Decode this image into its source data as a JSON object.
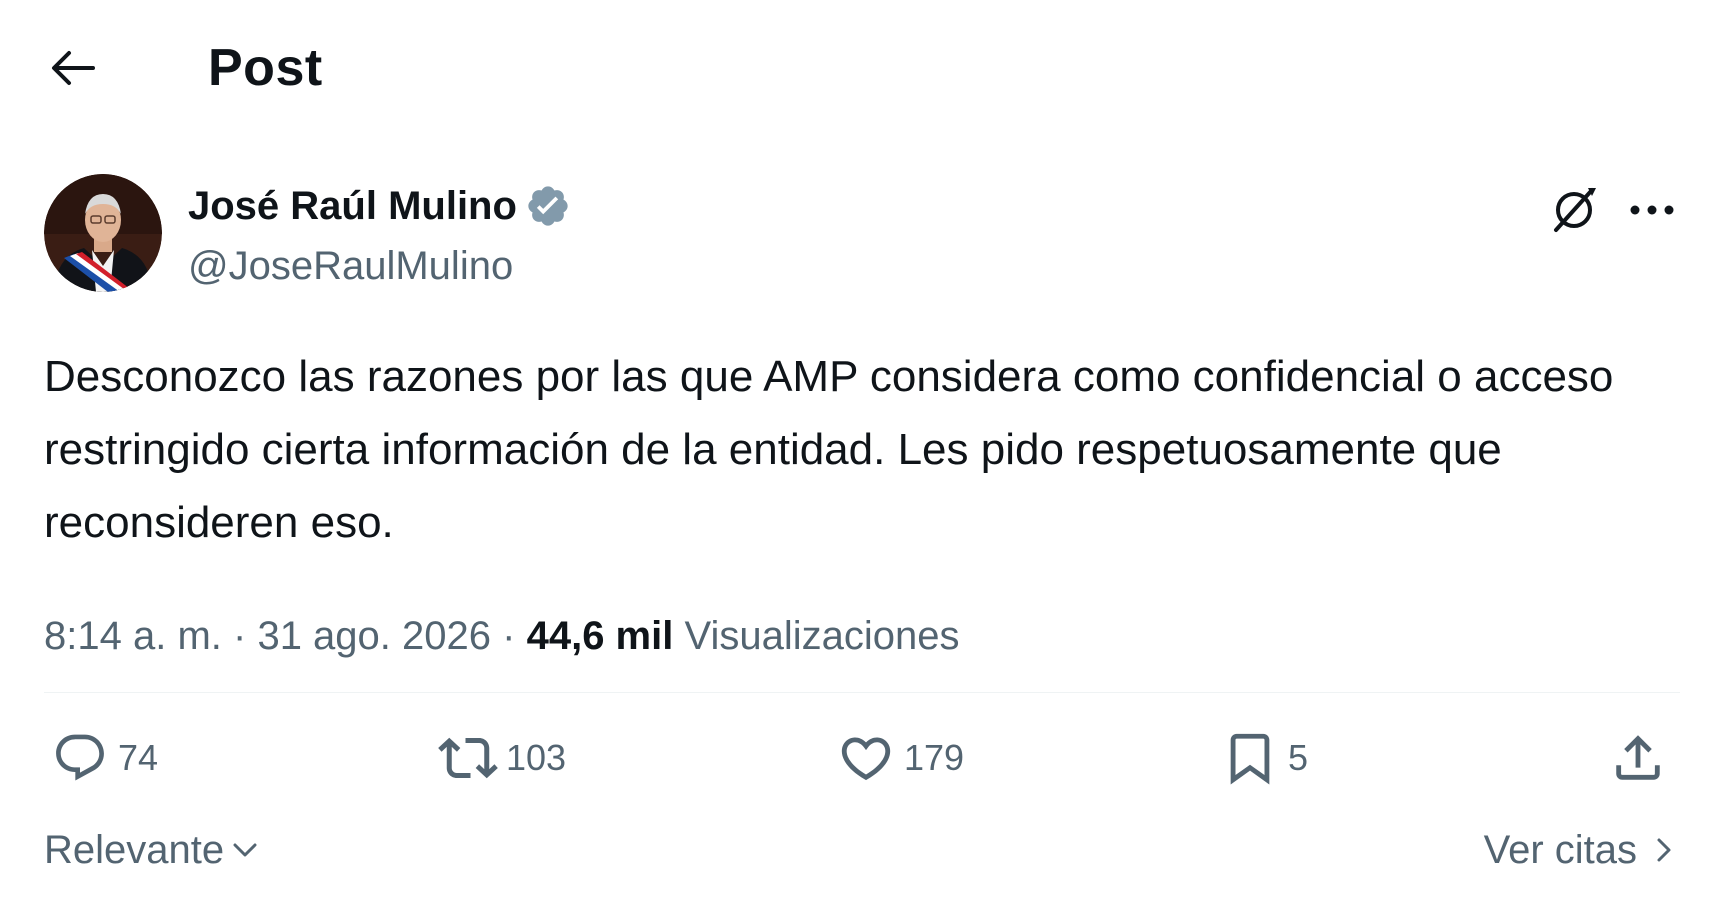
{
  "header": {
    "back_icon": "arrow-left-icon",
    "title": "Post"
  },
  "author": {
    "name": "José Raúl Mulino",
    "handle": "@JoseRaulMulino",
    "verified_icon": "verified-badge-icon",
    "verified_color": "#829aab"
  },
  "top_actions": {
    "grok_icon": "grok-icon",
    "more_icon": "more-horizontal-icon"
  },
  "post": {
    "text": "Desconozco las razones por las que AMP considera como confidencial o acceso restringido cierta información de la entidad. Les pido respetuosamente que reconsideren eso.",
    "time": "8:14 a. m.",
    "date": "31 ago. 2026",
    "separator": "·",
    "views_count": "44,6 mil",
    "views_label": "Visualizaciones"
  },
  "actions": {
    "reply": {
      "icon": "reply-icon",
      "count": "74"
    },
    "repost": {
      "icon": "repost-icon",
      "count": "103"
    },
    "like": {
      "icon": "heart-icon",
      "count": "179"
    },
    "bookmark": {
      "icon": "bookmark-icon",
      "count": "5"
    },
    "share": {
      "icon": "share-icon"
    }
  },
  "footer": {
    "sort_label": "Relevante",
    "quotes_label": "Ver citas"
  },
  "colors": {
    "text_primary": "#0f1419",
    "text_secondary": "#536471",
    "divider": "#eff3f4"
  }
}
